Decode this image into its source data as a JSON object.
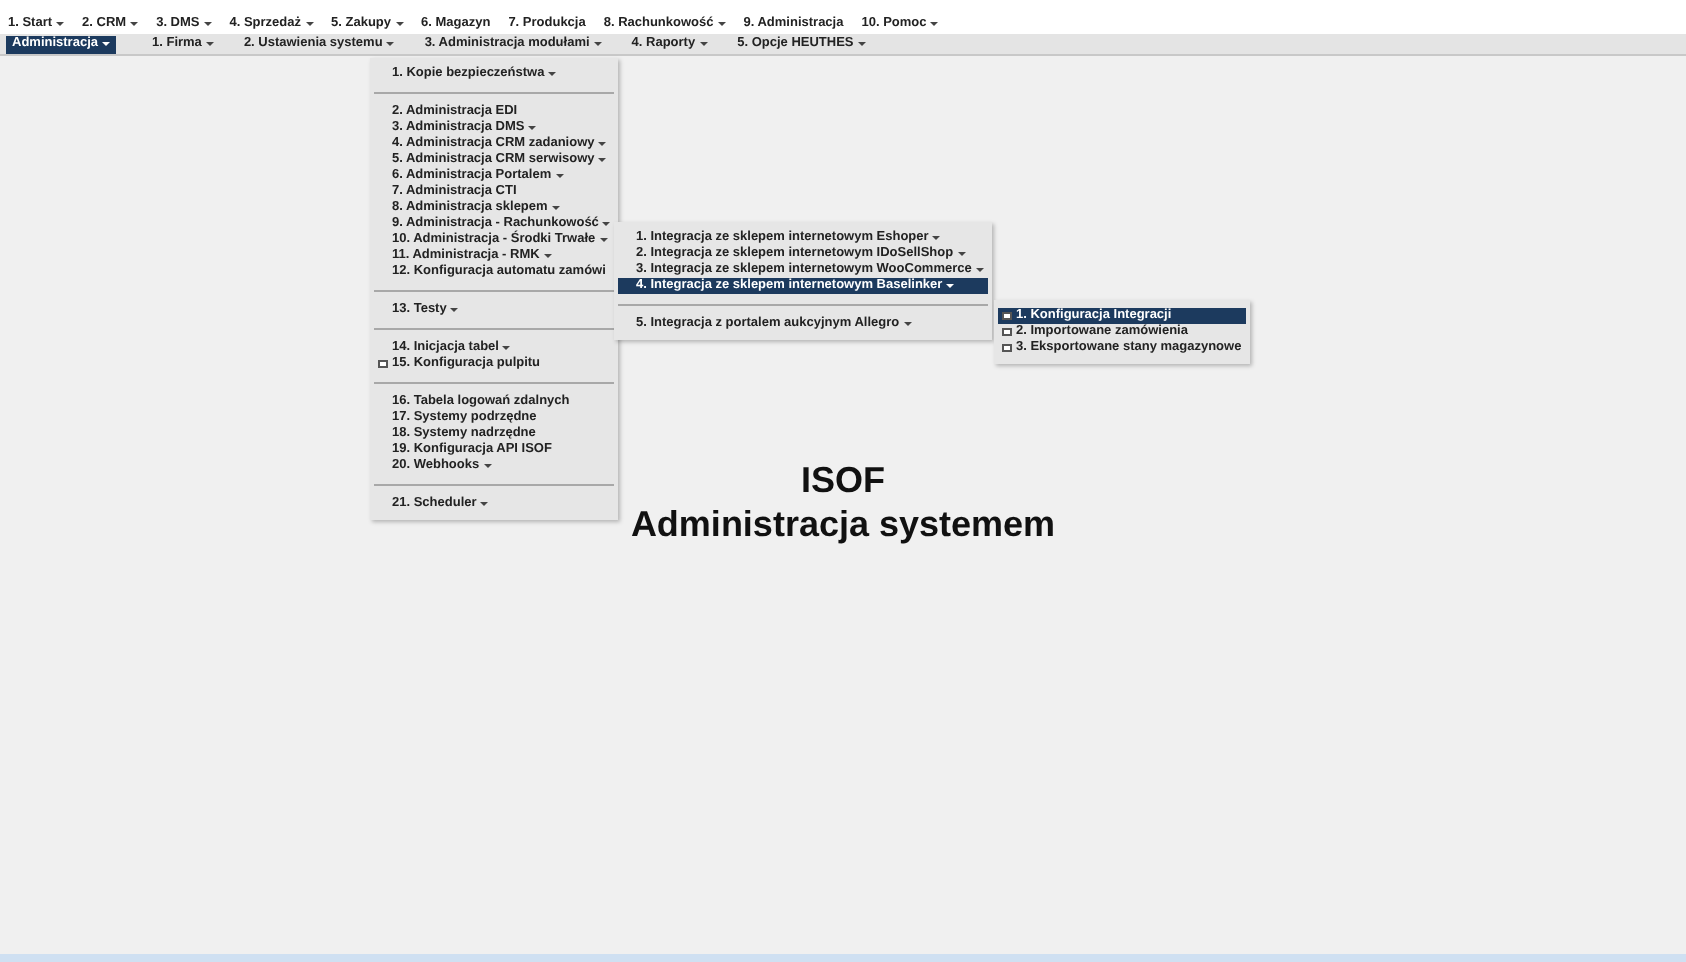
{
  "top_menu": [
    {
      "label": "1. Start",
      "has_submenu": true
    },
    {
      "label": "2. CRM",
      "has_submenu": true
    },
    {
      "label": "3. DMS",
      "has_submenu": true
    },
    {
      "label": "4. Sprzedaż",
      "has_submenu": true
    },
    {
      "label": "5. Zakupy",
      "has_submenu": true
    },
    {
      "label": "6. Magazyn",
      "has_submenu": false
    },
    {
      "label": "7. Produkcja",
      "has_submenu": false
    },
    {
      "label": "8. Rachunkowość",
      "has_submenu": true
    },
    {
      "label": "9. Administracja",
      "has_submenu": false
    },
    {
      "label": "10. Pomoc",
      "has_submenu": true
    }
  ],
  "sub_menu": [
    {
      "label": "Administracja",
      "has_submenu": true,
      "selected": true
    },
    {
      "label": "1. Firma",
      "has_submenu": true,
      "selected": false
    },
    {
      "label": "2. Ustawienia systemu",
      "has_submenu": true,
      "selected": false
    },
    {
      "label": "3. Administracja modułami",
      "has_submenu": true,
      "selected": false
    },
    {
      "label": "4. Raporty",
      "has_submenu": true,
      "selected": false
    },
    {
      "label": "5. Opcje HEUTHES",
      "has_submenu": true,
      "selected": false
    }
  ],
  "dropdowns": [
    {
      "groups": [
        [
          {
            "label": "1. Kopie bezpieczeństwa",
            "has_submenu": true,
            "icon": false,
            "selected": false
          }
        ],
        [
          {
            "label": "2. Administracja EDI",
            "has_submenu": false,
            "icon": false,
            "selected": false
          },
          {
            "label": "3. Administracja DMS",
            "has_submenu": true,
            "icon": false,
            "selected": false
          },
          {
            "label": "4. Administracja CRM zadaniowy",
            "has_submenu": true,
            "icon": false,
            "selected": false
          },
          {
            "label": "5. Administracja CRM serwisowy",
            "has_submenu": true,
            "icon": false,
            "selected": false
          },
          {
            "label": "6. Administracja Portalem",
            "has_submenu": true,
            "icon": false,
            "selected": false
          },
          {
            "label": "7. Administracja CTI",
            "has_submenu": false,
            "icon": false,
            "selected": false
          },
          {
            "label": "8. Administracja sklepem",
            "has_submenu": true,
            "icon": false,
            "selected": false
          },
          {
            "label": "9. Administracja - Rachunkowość",
            "has_submenu": true,
            "icon": false,
            "selected": false
          },
          {
            "label": "10. Administracja - Środki Trwałe",
            "has_submenu": true,
            "icon": false,
            "selected": false
          },
          {
            "label": "11. Administracja - RMK",
            "has_submenu": true,
            "icon": false,
            "selected": false
          },
          {
            "label": "12. Konfiguracja automatu zamówi",
            "has_submenu": false,
            "icon": false,
            "selected": false
          }
        ],
        [
          {
            "label": "13. Testy",
            "has_submenu": true,
            "icon": false,
            "selected": false
          }
        ],
        [
          {
            "label": "14. Inicjacja tabel",
            "has_submenu": true,
            "icon": false,
            "selected": false
          },
          {
            "label": "15. Konfiguracja pulpitu",
            "has_submenu": false,
            "icon": true,
            "selected": false
          }
        ],
        [
          {
            "label": "16. Tabela logowań zdalnych",
            "has_submenu": false,
            "icon": false,
            "selected": false
          },
          {
            "label": "17. Systemy podrzędne",
            "has_submenu": false,
            "icon": false,
            "selected": false
          },
          {
            "label": "18. Systemy nadrzędne",
            "has_submenu": false,
            "icon": false,
            "selected": false
          },
          {
            "label": "19. Konfiguracja API ISOF",
            "has_submenu": false,
            "icon": false,
            "selected": false
          },
          {
            "label": "20. Webhooks",
            "has_submenu": true,
            "icon": false,
            "selected": false
          }
        ],
        [
          {
            "label": "21. Scheduler",
            "has_submenu": true,
            "icon": false,
            "selected": false
          }
        ]
      ]
    },
    {
      "groups": [
        [
          {
            "label": "1. Integracja ze sklepem internetowym Eshoper",
            "has_submenu": true,
            "icon": false,
            "selected": false
          },
          {
            "label": "2. Integracja ze sklepem internetowym IDoSellShop",
            "has_submenu": true,
            "icon": false,
            "selected": false
          },
          {
            "label": "3. Integracja ze sklepem internetowym WooCommerce",
            "has_submenu": true,
            "icon": false,
            "selected": false
          },
          {
            "label": "4. Integracja ze sklepem internetowym Baselinker",
            "has_submenu": true,
            "icon": false,
            "selected": true
          }
        ],
        [
          {
            "label": "5. Integracja z portalem aukcyjnym Allegro",
            "has_submenu": true,
            "icon": false,
            "selected": false
          }
        ]
      ]
    },
    {
      "groups": [
        [
          {
            "label": "1. Konfiguracja Integracji",
            "has_submenu": false,
            "icon": true,
            "selected": true
          },
          {
            "label": "2. Importowane zamówienia",
            "has_submenu": false,
            "icon": true,
            "selected": false
          },
          {
            "label": "3. Eksportowane stany magazynowe",
            "has_submenu": false,
            "icon": true,
            "selected": false
          }
        ]
      ]
    }
  ],
  "heading": {
    "title": "ISOF",
    "subtitle": "Administracja systemem"
  }
}
